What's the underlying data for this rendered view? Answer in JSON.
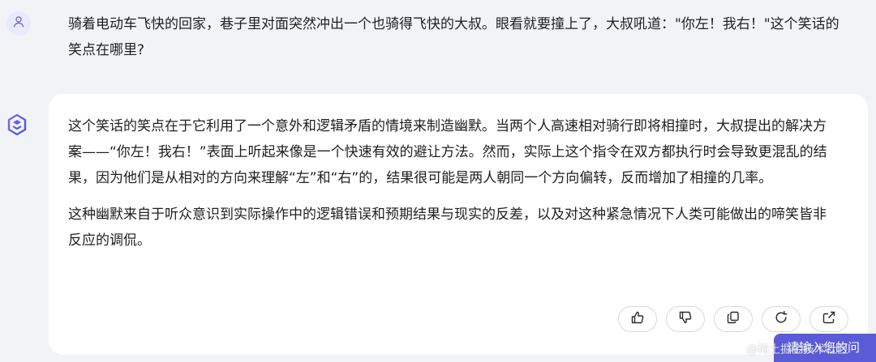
{
  "user_message": {
    "avatar_icon": "user-icon",
    "text": "骑着电动车飞快的回家，巷子里对面突然冲出一个也骑得飞快的大叔。眼看就要撞上了，大叔吼道：\"你左！我右！\"这个笑话的笑点在哪里?"
  },
  "assistant_message": {
    "avatar_icon": "bot-logo-icon",
    "paragraphs": [
      "这个笑话的笑点在于它利用了一个意外和逻辑矛盾的情境来制造幽默。当两个人高速相对骑行即将相撞时，大叔提出的解决方案——“你左！我右！”表面上听起来像是一个快速有效的避让方法。然而，实际上这个指令在双方都执行时会导致更混乱的结果，因为他们是从相对的方向来理解“左”和“右”的，结果很可能是两人朝同一个方向偏转，反而增加了相撞的几率。",
      "这种幽默来自于听众意识到实际操作中的逻辑错误和预期结果与现实的反差，以及对这种紧急情况下人类可能做出的啼笑皆非反应的调侃。"
    ],
    "actions": [
      {
        "name": "like-button",
        "icon": "thumbs-up-icon"
      },
      {
        "name": "dislike-button",
        "icon": "thumbs-down-icon"
      },
      {
        "name": "copy-button",
        "icon": "copy-icon"
      },
      {
        "name": "regenerate-button",
        "icon": "refresh-icon"
      },
      {
        "name": "share-button",
        "icon": "share-icon"
      }
    ]
  },
  "input_chip": {
    "text": "请输入您的问"
  },
  "watermark": "@稀土掘金技术社区",
  "colors": {
    "page_bg": "#f2f3f7",
    "card_bg": "#ffffff",
    "accent": "#5b5bd8",
    "text": "#1f1f1f"
  }
}
